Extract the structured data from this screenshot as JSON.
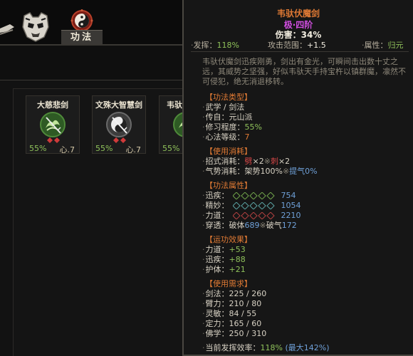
{
  "tabs": {
    "active_label": "功法"
  },
  "skills": [
    {
      "name": "大慈悲剑",
      "progress": "55%",
      "level": "心.7",
      "icon": "green-sword-orb"
    },
    {
      "name": "文殊大智慧剑",
      "progress": "55%",
      "level": "心.7",
      "icon": "taiji-sword-orb"
    },
    {
      "name": "韦驮",
      "progress": "55%",
      "level": "",
      "icon": "green-sword-orb"
    }
  ],
  "tooltip": {
    "title": "韦驮伏魔剑",
    "grade": "极·四阶",
    "damage": "伤害：34%",
    "stats": {
      "play_label": "发挥：",
      "play_value": "118%",
      "range_label": "攻击范围：",
      "range_value": "+1.5",
      "attr_label": "属性：",
      "attr_value": "归元"
    },
    "description": "韦驮伏魔剑迅疾刚勇，剑出有金光，可瞬间击出数十丈之远，其威势之坚强，好似韦驮天手持宝杵以镇群魔，凛然不可侵犯，绝无消退移转。",
    "sections": {
      "type_head": "【功法类型】",
      "type_rows": [
        {
          "label": "武学 / 剑法",
          "value": ""
        },
        {
          "label": "传自：",
          "value": "元山派"
        },
        {
          "label": "修习程度：",
          "value": "55%"
        },
        {
          "label": "心法等级：",
          "value": "7"
        }
      ],
      "cost_head": "【使用消耗】",
      "cost_move_label": "招式消耗：",
      "cost_move_a": "劈",
      "cost_move_a_count": "×2",
      "cost_move_b": "刺",
      "cost_move_b_count": "×2",
      "cost_stance_label": "气势消耗：",
      "cost_stance_a": "架势100%",
      "cost_stance_b": "提气0%",
      "attr_head": "【功法属性】",
      "attr_rows": [
        {
          "label": "迅疾：",
          "value": "754",
          "color": "#6fa24a"
        },
        {
          "label": "精妙：",
          "value": "1054",
          "color": "#5aa0a0"
        },
        {
          "label": "力道：",
          "value": "2210",
          "color": "#b04040"
        }
      ],
      "pierce_label": "穿透：",
      "pierce_a_label": "破体",
      "pierce_a_value": "689",
      "pierce_b_label": "破气",
      "pierce_b_value": "172",
      "effect_head": "【运功效果】",
      "effect_rows": [
        {
          "label": "力道：",
          "value": "+53"
        },
        {
          "label": "迅疾：",
          "value": "+88"
        },
        {
          "label": "护体：",
          "value": "+21"
        }
      ],
      "req_head": "【使用需求】",
      "req_rows": [
        {
          "label": "剑法：",
          "value": "225 / 260"
        },
        {
          "label": "臂力：",
          "value": "210 / 80"
        },
        {
          "label": "灵敏：",
          "value": "84 / 55"
        },
        {
          "label": "定力：",
          "value": "165 / 60"
        },
        {
          "label": "佛学：",
          "value": "250 / 310"
        }
      ],
      "efficiency_label": "当前发挥效率：",
      "efficiency_value": "118%",
      "efficiency_max": "(最大142%)"
    }
  }
}
